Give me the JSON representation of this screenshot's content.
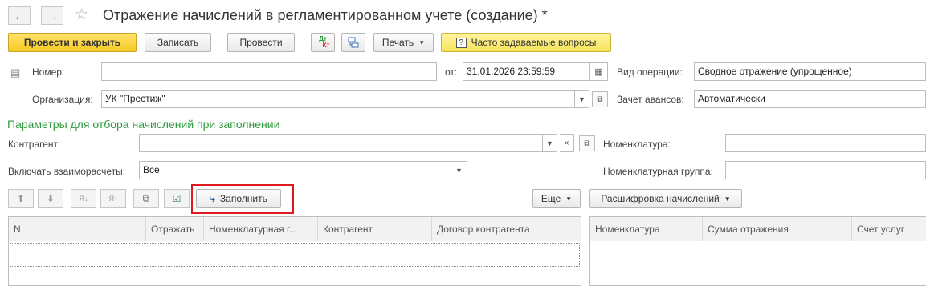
{
  "window": {
    "title": "Отражение начислений в регламентированном учете (создание) *"
  },
  "toolbar": {
    "post_close": "Провести и закрыть",
    "save": "Записать",
    "post": "Провести",
    "dtkt_top": "Дт",
    "dtkt_bottom": "Кт",
    "print": "Печать",
    "faq": "Часто задаваемые вопросы"
  },
  "form": {
    "number_label": "Номер:",
    "number_value": "",
    "date_label": "от:",
    "date_value": "31.01.2026 23:59:59",
    "op_label": "Вид операции:",
    "op_value": "Сводное отражение (упрощенное)",
    "org_label": "Организация:",
    "org_value": "УК \"Престиж\"",
    "advance_label": "Зачет авансов:",
    "advance_value": "Автоматически"
  },
  "filter": {
    "title": "Параметры для отбора начислений при заполнении",
    "contragent_label": "Контрагент:",
    "contragent_value": "",
    "nomenclature_label": "Номенклатура:",
    "mutual_label": "Включать взаиморасчеты:",
    "mutual_value": "Все",
    "nomgroup_label": "Номенклатурная группа:"
  },
  "grid_toolbar": {
    "fill": "Заполнить",
    "more": "Еще",
    "breakdown": "Расшифровка начислений"
  },
  "left_table": {
    "columns": [
      "N",
      "Отражать",
      "Номенклатурная г...",
      "Контрагент",
      "Договор контрагента"
    ]
  },
  "right_table": {
    "columns": [
      "Номенклатура",
      "Сумма отражения",
      "Счет услуг"
    ]
  },
  "colors": {
    "accent_green": "#2e9b3c",
    "highlight_red": "#e0191f",
    "primary_yellow": "#f6c924"
  }
}
